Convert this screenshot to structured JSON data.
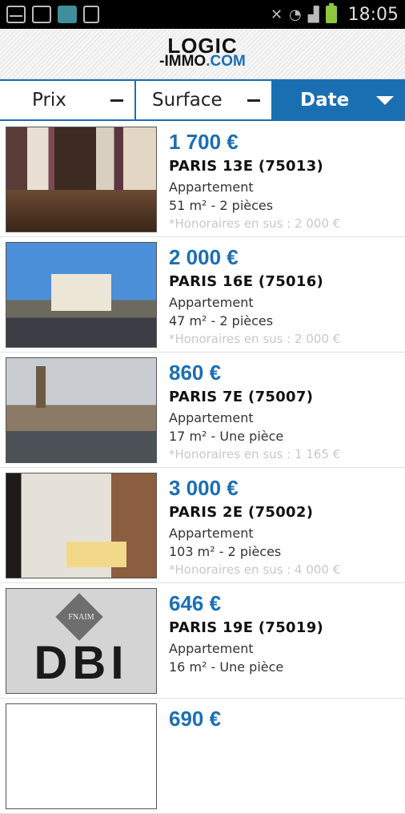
{
  "status_bar": {
    "time": "18:05"
  },
  "logo": {
    "line1": "LOGIC",
    "line2_prefix": "-IMMO",
    "line2_suffix": ".COM"
  },
  "sort": {
    "prix": "Prix",
    "surface": "Surface",
    "date": "Date"
  },
  "listings": [
    {
      "price": "1 700 €",
      "city": "PARIS 13E (75013)",
      "type": "Appartement",
      "dims": "51 m² - 2 pièces",
      "fees": "*Honoraires en sus : 2 000 €"
    },
    {
      "price": "2 000 €",
      "city": "PARIS 16E (75016)",
      "type": "Appartement",
      "dims": "47 m² - 2 pièces",
      "fees": "*Honoraires en sus : 2 000 €"
    },
    {
      "price": "860 €",
      "city": "PARIS 7E (75007)",
      "type": "Appartement",
      "dims": "17 m² - Une pièce",
      "fees": "*Honoraires en sus : 1 165 €"
    },
    {
      "price": "3 000 €",
      "city": "PARIS 2E (75002)",
      "type": "Appartement",
      "dims": "103 m² - 2 pièces",
      "fees": "*Honoraires en sus : 4 000 €"
    },
    {
      "price": "646 €",
      "city": "PARIS 19E (75019)",
      "type": "Appartement",
      "dims": "16 m² - Une pièce",
      "fees": "",
      "logo_text": "DBI",
      "logo_badge": "FNAIM"
    },
    {
      "price": "690 €"
    }
  ]
}
